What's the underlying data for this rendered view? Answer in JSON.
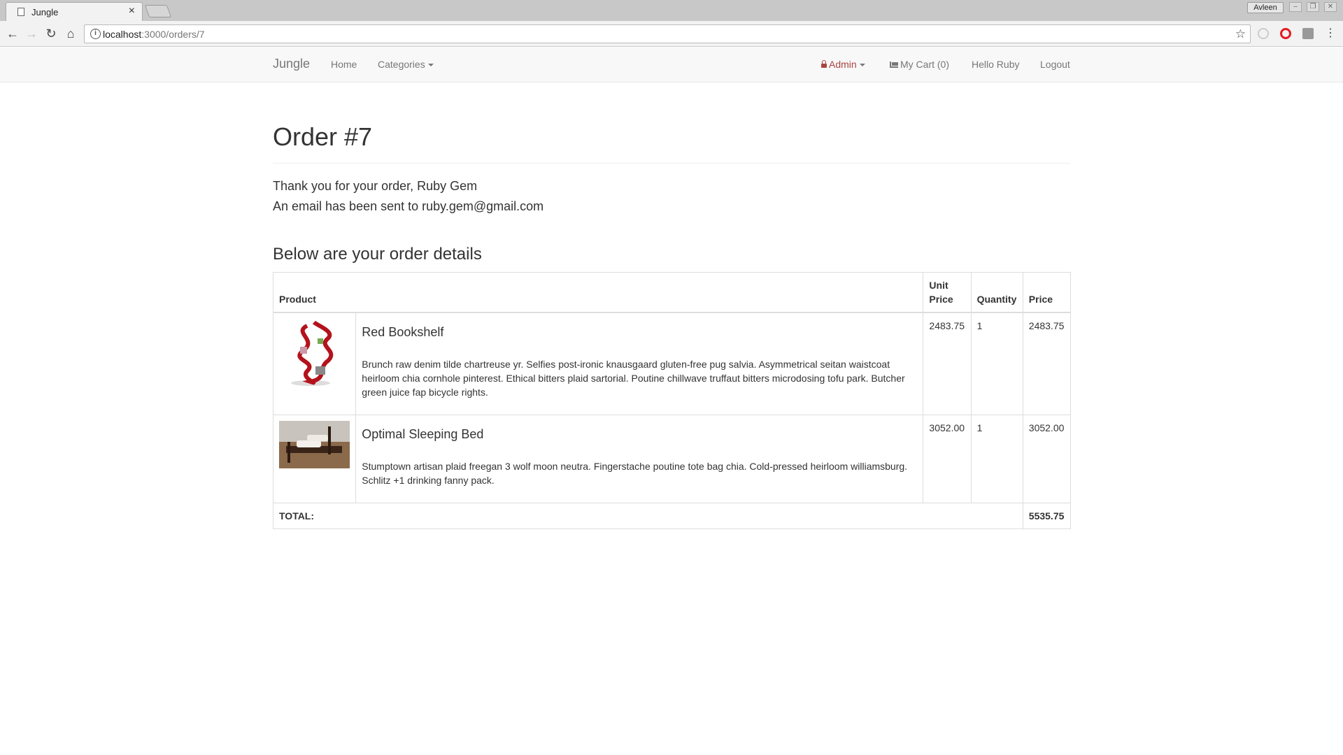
{
  "browser": {
    "tab_title": "Jungle",
    "tab_close": "×",
    "profile_name": "Avleen",
    "url_host": "localhost",
    "url_path": ":3000/orders/7",
    "info_icon": "i"
  },
  "navbar": {
    "brand": "Jungle",
    "home": "Home",
    "categories": "Categories",
    "admin": "Admin",
    "cart": "My Cart (0)",
    "greeting": "Hello Ruby",
    "logout": "Logout"
  },
  "order": {
    "title": "Order #7",
    "thanks": "Thank you for your order, Ruby Gem",
    "email_sent": "An email has been sent to ruby.gem@gmail.com",
    "details_heading": "Below are your order details"
  },
  "table": {
    "headers": {
      "product": "Product",
      "unit_price_line1": "Unit",
      "unit_price_line2": "Price",
      "quantity": "Quantity",
      "price": "Price"
    },
    "rows": [
      {
        "name": "Red Bookshelf",
        "description": "Brunch raw denim tilde chartreuse yr. Selfies post-ironic knausgaard gluten-free pug salvia. Asymmetrical seitan waistcoat heirloom chia cornhole pinterest. Ethical bitters plaid sartorial. Poutine chillwave truffaut bitters microdosing tofu park. Butcher green juice fap bicycle rights.",
        "unit_price": "2483.75",
        "quantity": "1",
        "price": "2483.75"
      },
      {
        "name": "Optimal Sleeping Bed",
        "description": "Stumptown artisan plaid freegan 3 wolf moon neutra. Fingerstache poutine tote bag chia. Cold-pressed heirloom williamsburg. Schlitz +1 drinking fanny pack.",
        "unit_price": "3052.00",
        "quantity": "1",
        "price": "3052.00"
      }
    ],
    "total_label": "TOTAL:",
    "total_value": "5535.75"
  },
  "colors": {
    "admin": "#a94442",
    "navbar_bg": "#f8f8f8",
    "link_gray": "#777777"
  }
}
